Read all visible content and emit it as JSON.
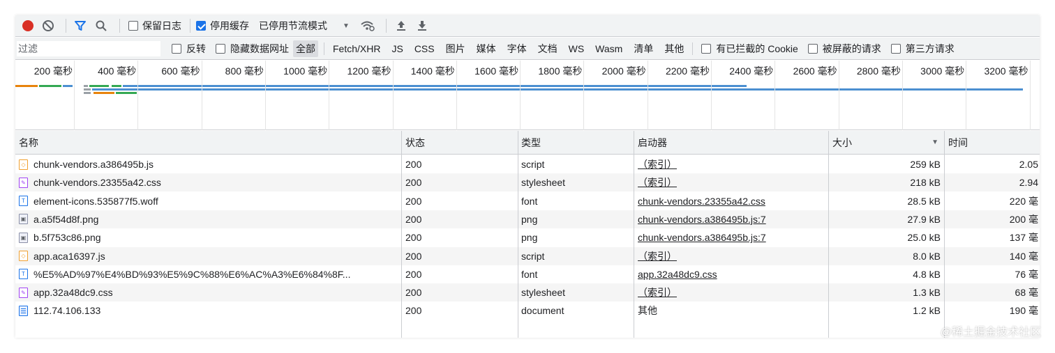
{
  "colors": {
    "accent": "#1a73e8",
    "record": "#d93025",
    "bar_blue": "#4b8fd1",
    "bar_green": "#34a853",
    "bar_orange": "#e8830c"
  },
  "toolbar": {
    "record_icon": "record-icon",
    "clear_icon": "clear-icon",
    "filter_icon": "filter-icon",
    "search_icon": "search-icon",
    "preserve_log": {
      "label": "保留日志",
      "checked": false
    },
    "disable_cache": {
      "label": "停用缓存",
      "checked": true
    },
    "throttling": {
      "label": "已停用节流模式"
    },
    "wifi_icon": "network-conditions-icon",
    "upload_icon": "import-icon",
    "download_icon": "export-icon"
  },
  "filterbar": {
    "filter_placeholder": "过滤",
    "invert": {
      "label": "反转",
      "checked": false
    },
    "hide_data_urls": {
      "label": "隐藏数据网址",
      "checked": false
    },
    "types": [
      "全部",
      "Fetch/XHR",
      "JS",
      "CSS",
      "图片",
      "媒体",
      "字体",
      "文档",
      "WS",
      "Wasm",
      "清单",
      "其他"
    ],
    "active_type": "全部",
    "blocked_cookies": {
      "label": "有已拦截的 Cookie",
      "checked": false
    },
    "blocked_requests": {
      "label": "被屏蔽的请求",
      "checked": false
    },
    "third_party": {
      "label": "第三方请求",
      "checked": false
    }
  },
  "overview": {
    "ticks": [
      "200 毫秒",
      "400 毫秒",
      "600 毫秒",
      "800 毫秒",
      "1000 毫秒",
      "1200 毫秒",
      "1400 毫秒",
      "1600 毫秒",
      "1800 毫秒",
      "2000 毫秒",
      "2200 毫秒",
      "2400 毫秒",
      "2600 毫秒",
      "2800 毫秒",
      "3000 毫秒",
      "3200 毫秒"
    ]
  },
  "table": {
    "headers": {
      "name": "名称",
      "status": "状态",
      "type": "类型",
      "initiator": "启动器",
      "size": "大小",
      "time": "时间"
    },
    "sort_icon": "sort-descending-icon",
    "rows": [
      {
        "icon": "js",
        "name": "chunk-vendors.a386495b.js",
        "status": "200",
        "type": "script",
        "initiator": "（索引）",
        "size": "259 kB",
        "time": "2.05"
      },
      {
        "icon": "css",
        "name": "chunk-vendors.23355a42.css",
        "status": "200",
        "type": "stylesheet",
        "initiator": "（索引）",
        "size": "218 kB",
        "time": "2.94"
      },
      {
        "icon": "font",
        "name": "element-icons.535877f5.woff",
        "status": "200",
        "type": "font",
        "initiator": "chunk-vendors.23355a42.css",
        "size": "28.5 kB",
        "time": "220 毫"
      },
      {
        "icon": "img",
        "name": "a.a5f54d8f.png",
        "status": "200",
        "type": "png",
        "initiator": "chunk-vendors.a386495b.js:7",
        "size": "27.9 kB",
        "time": "200 毫"
      },
      {
        "icon": "img",
        "name": "b.5f753c86.png",
        "status": "200",
        "type": "png",
        "initiator": "chunk-vendors.a386495b.js:7",
        "size": "25.0 kB",
        "time": "137 毫"
      },
      {
        "icon": "js",
        "name": "app.aca16397.js",
        "status": "200",
        "type": "script",
        "initiator": "（索引）",
        "size": "8.0 kB",
        "time": "140 毫"
      },
      {
        "icon": "font",
        "name": "%E5%AD%97%E4%BD%93%E5%9C%88%E6%AC%A3%E6%84%8F...",
        "status": "200",
        "type": "font",
        "initiator": "app.32a48dc9.css",
        "size": "4.8 kB",
        "time": "76 毫"
      },
      {
        "icon": "css",
        "name": "app.32a48dc9.css",
        "status": "200",
        "type": "stylesheet",
        "initiator": "（索引）",
        "size": "1.3 kB",
        "time": "68 毫"
      },
      {
        "icon": "doc",
        "name": "112.74.106.133",
        "status": "200",
        "type": "document",
        "initiator": "其他",
        "size": "1.2 kB",
        "time": "190 毫"
      }
    ]
  },
  "watermark": "@稀土掘金技术社区"
}
